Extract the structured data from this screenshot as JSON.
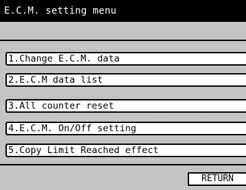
{
  "header": {
    "title": "E.C.M. setting menu"
  },
  "menu": {
    "items": [
      {
        "label": "1.Change E.C.M. data"
      },
      {
        "label": "2.E.C.M data list"
      },
      {
        "label": "3.All counter reset"
      },
      {
        "label": "4.E.C.M. On/Off setting"
      },
      {
        "label": "5.Copy Limit Reached effect"
      }
    ]
  },
  "footer": {
    "return_label": "RETURN"
  }
}
